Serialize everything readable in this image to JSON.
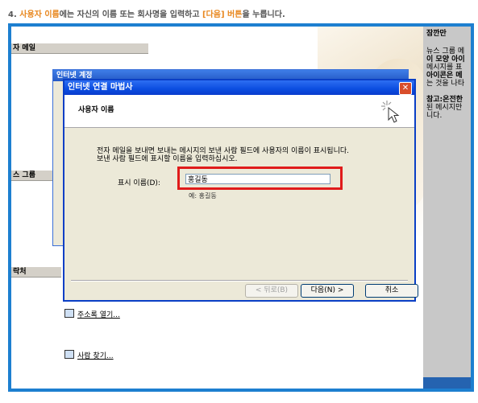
{
  "instruction": {
    "prefix": "4. ",
    "hl1": "사용자 이름",
    "mid": "에는 자신의 이름 또는 회사명을 입력하고 ",
    "hl2": "[다음] 버튼",
    "suffix": "을 누릅니다."
  },
  "background": {
    "bar1": "자 메일",
    "bar2": "스 그룹",
    "bar3": "락처",
    "link1": "주소록 열기...",
    "link2": "사람 찾기...",
    "behind_title": "인터넷 계정"
  },
  "right_panel": {
    "title": "잠깐만",
    "lines": [
      "뉴스 그룹 메",
      "이 모양 아이",
      "메시지를 표",
      "아이콘은 메",
      "는 것을 나타"
    ],
    "note_lines": [
      "참고:온전한",
      "된 메시지만",
      "니다."
    ]
  },
  "wizard": {
    "title": "인터넷 연결 마법사",
    "close": "✕",
    "header_title": "사용자 이름",
    "desc_line1": "전자 메일을 보내면 보내는 메시지의 보낸 사람 필드에 사용자의 이름이 표시됩니다.",
    "desc_line2": "보낸 사람 필드에 표시할 이름을 입력하십시오.",
    "field_label": "표시 이름(D):",
    "field_value": "홍길동",
    "example": "예: 홍길동",
    "btn_back": "< 뒤로(B)",
    "btn_next": "다음(N) >",
    "btn_cancel": "취소"
  },
  "colors": {
    "frame": "#1d7fd0",
    "highlight": "#e01b1b",
    "accent_text": "#e8871e"
  }
}
